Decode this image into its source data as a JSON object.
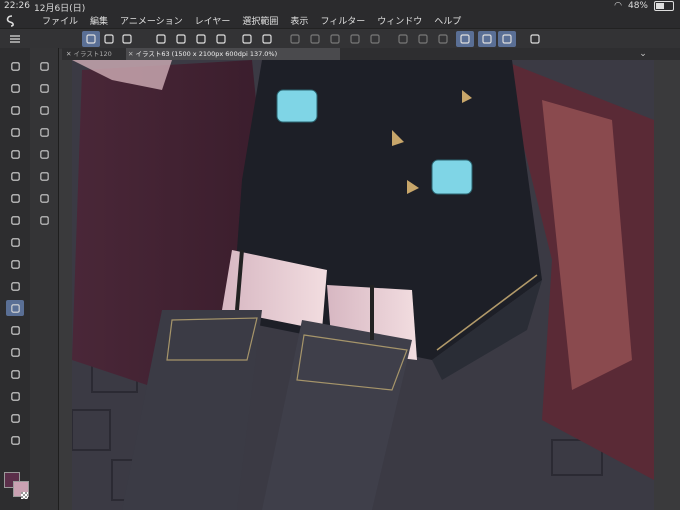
{
  "status": {
    "time": "22:26",
    "date": "12月6日(日)",
    "battery": "48%",
    "battery_level": 0.48
  },
  "menus": [
    "ファイル",
    "編集",
    "アニメーション",
    "レイヤー",
    "選択範囲",
    "表示",
    "フィルター",
    "ウィンドウ",
    "ヘルプ"
  ],
  "tabs": [
    {
      "label": "イラスト120",
      "active": false
    },
    {
      "label": "イラスト63 (1500 x 2100px 600dpi 137.0%)",
      "active": true
    }
  ],
  "colors": {
    "main_color": "#5b2f4a",
    "sub_color": "#c9a1b2",
    "accent": "#5a6f95"
  },
  "toolbar_icons": [
    "menu-icon",
    "brush-size-icon",
    "stepper-icon",
    "snap-icon",
    "new-icon",
    "open-icon",
    "save-icon",
    "export-icon",
    "undo-icon",
    "redo-icon",
    "deselect-icon",
    "select-all-icon",
    "invert-icon",
    "fill-icon",
    "transform-icon",
    "clear-icon",
    "clear-outside-icon",
    "crop-icon",
    "ruler-snap-icon",
    "special-ruler-icon",
    "grid-snap-icon",
    "help-icon"
  ],
  "tools": [
    "magnifier",
    "hand",
    "operation",
    "move",
    "eyedropper",
    "auto-select",
    "lasso",
    "pen",
    "pencil",
    "brush",
    "airbrush",
    "decoration",
    "blend",
    "fill",
    "gradient",
    "eraser",
    "figure",
    "line"
  ],
  "subtools": [
    "layer-move",
    "layer-select",
    "timeline",
    "layer",
    "color-wheel",
    "color-set",
    "navigator",
    "material"
  ]
}
